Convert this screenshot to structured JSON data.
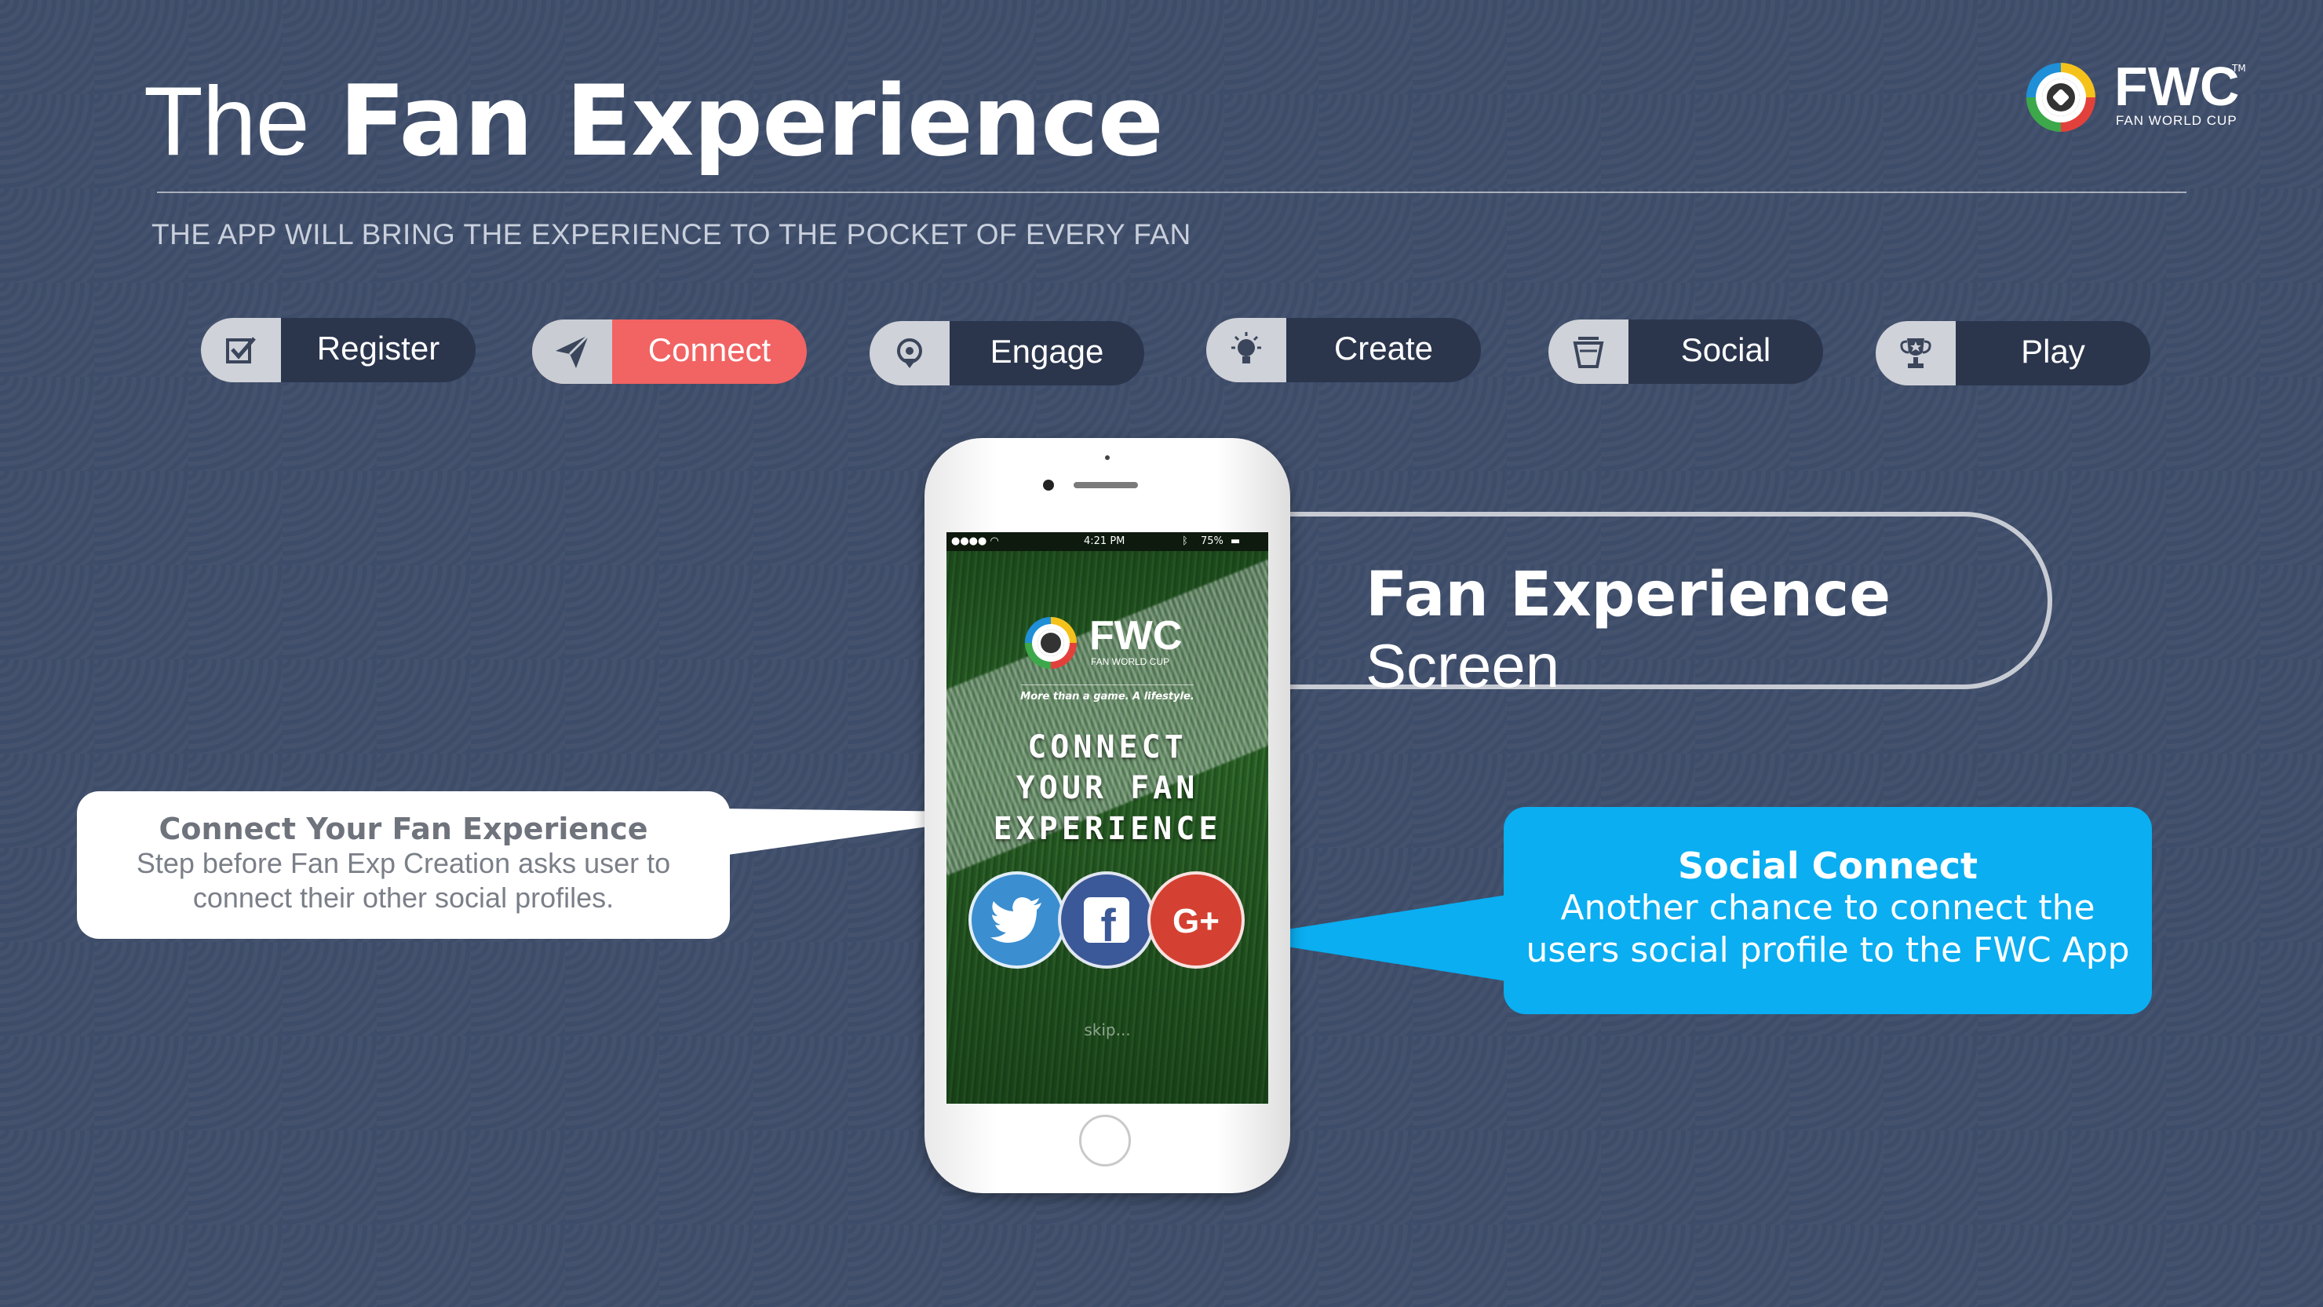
{
  "header": {
    "title_light": "The",
    "title_bold": "Fan Experience",
    "subtitle": "THE APP WILL BRING THE EXPERIENCE TO THE POCKET OF EVERY FAN"
  },
  "logo": {
    "text": "FWC",
    "trademark": "TM",
    "tagline": "FAN WORLD CUP"
  },
  "tabs": [
    {
      "label": "Register",
      "icon": "checkbox-icon",
      "active": false
    },
    {
      "label": "Connect",
      "icon": "paper-plane-icon",
      "active": true
    },
    {
      "label": "Engage",
      "icon": "map-pin-icon",
      "active": false
    },
    {
      "label": "Create",
      "icon": "lightbulb-icon",
      "active": false
    },
    {
      "label": "Social",
      "icon": "coffee-cup-icon",
      "active": false
    },
    {
      "label": "Play",
      "icon": "trophy-icon",
      "active": false
    }
  ],
  "phone_screen": {
    "status_time": "4:21 PM",
    "status_battery": "75%",
    "logo_text": "FWC",
    "logo_tagline": "FAN WORLD CUP",
    "motto": "More than a game. A lifestyle.",
    "headline_line1": "CONNECT",
    "headline_line2": "YOUR FAN",
    "headline_line3": "EXPERIENCE",
    "social_buttons": [
      {
        "name": "twitter",
        "icon": "twitter-icon"
      },
      {
        "name": "facebook",
        "icon": "facebook-icon",
        "glyph": "f"
      },
      {
        "name": "google-plus",
        "icon": "google-plus-icon",
        "glyph": "G+"
      }
    ],
    "skip": "skip..."
  },
  "screen_callout": {
    "bold": "Fan Experience",
    "rest": " Screen"
  },
  "left_callout": {
    "title": "Connect Your Fan Experience",
    "line1": "Step before Fan Exp Creation asks user to",
    "line2": "connect their other social profiles."
  },
  "right_callout": {
    "title": "Social Connect",
    "line1": "Another chance to connect the",
    "line2": "users social profile to the FWC App"
  },
  "colors": {
    "background": "#3f4e6b",
    "active_tab": "#f26363",
    "tab_dark": "#2b364d",
    "social_callout": "#0aaef1"
  }
}
